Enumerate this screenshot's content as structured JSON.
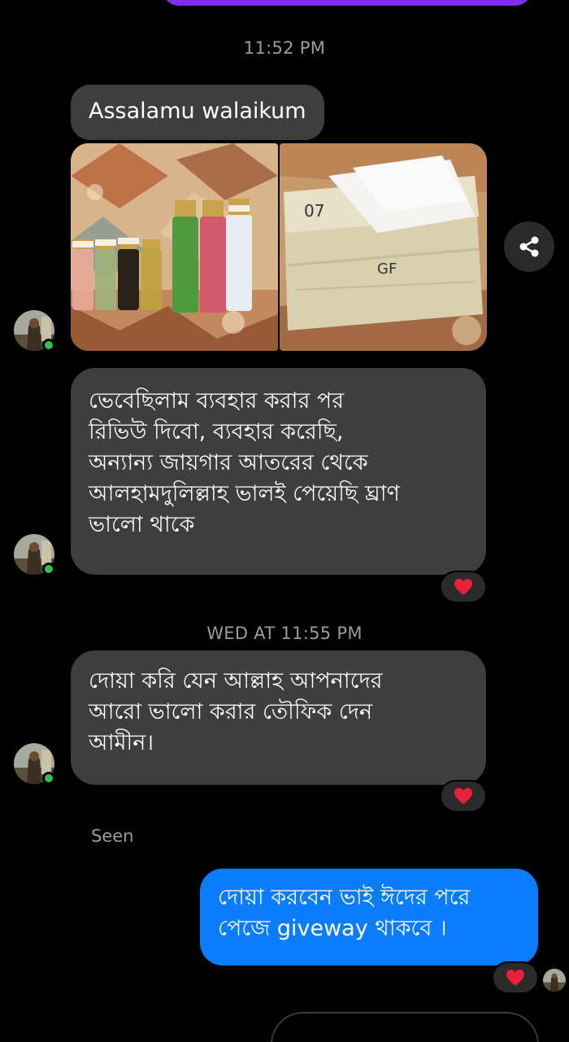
{
  "header": {
    "accent_color": "#7e2fe6"
  },
  "conversation": {
    "timestamp_1": "11:52 PM",
    "message_1": "Assalamu walaikum",
    "attachments": [
      {
        "name": "perfume-bottles-photo"
      },
      {
        "name": "package-photo"
      }
    ],
    "share_icon": "share-icon",
    "message_2_lines": [
      "ভেবেছিলাম ব্যবহার করার পর",
      "রিভিউ দিবো, ব্যবহার করেছি,",
      "অন্যান্য জায়গার আতরের থেকে",
      "আলহামদুলিল্লাহ ভালই পেয়েছি ঘ্রাণ",
      "ভালো থাকে"
    ],
    "reaction_1": "heart-icon",
    "timestamp_2": "WED AT 11:55 PM",
    "message_3_lines": [
      "দোয়া করি যেন আল্লাহ আপনাদের",
      "আরো ভালো করার তৌফিক দেন",
      "আমীন।"
    ],
    "reaction_2": "heart-icon",
    "seen_label": "Seen",
    "outgoing_lines": [
      "দোয়া করবেন ভাই ঈদের পরে",
      "পেজে giveway থাকবে ।"
    ],
    "reaction_3": "heart-icon"
  },
  "colors": {
    "incoming_bubble": "#3e3e3e",
    "outgoing_bubble": "#0a7cff",
    "online_dot": "#31c24b",
    "heart": "#e8203a"
  }
}
